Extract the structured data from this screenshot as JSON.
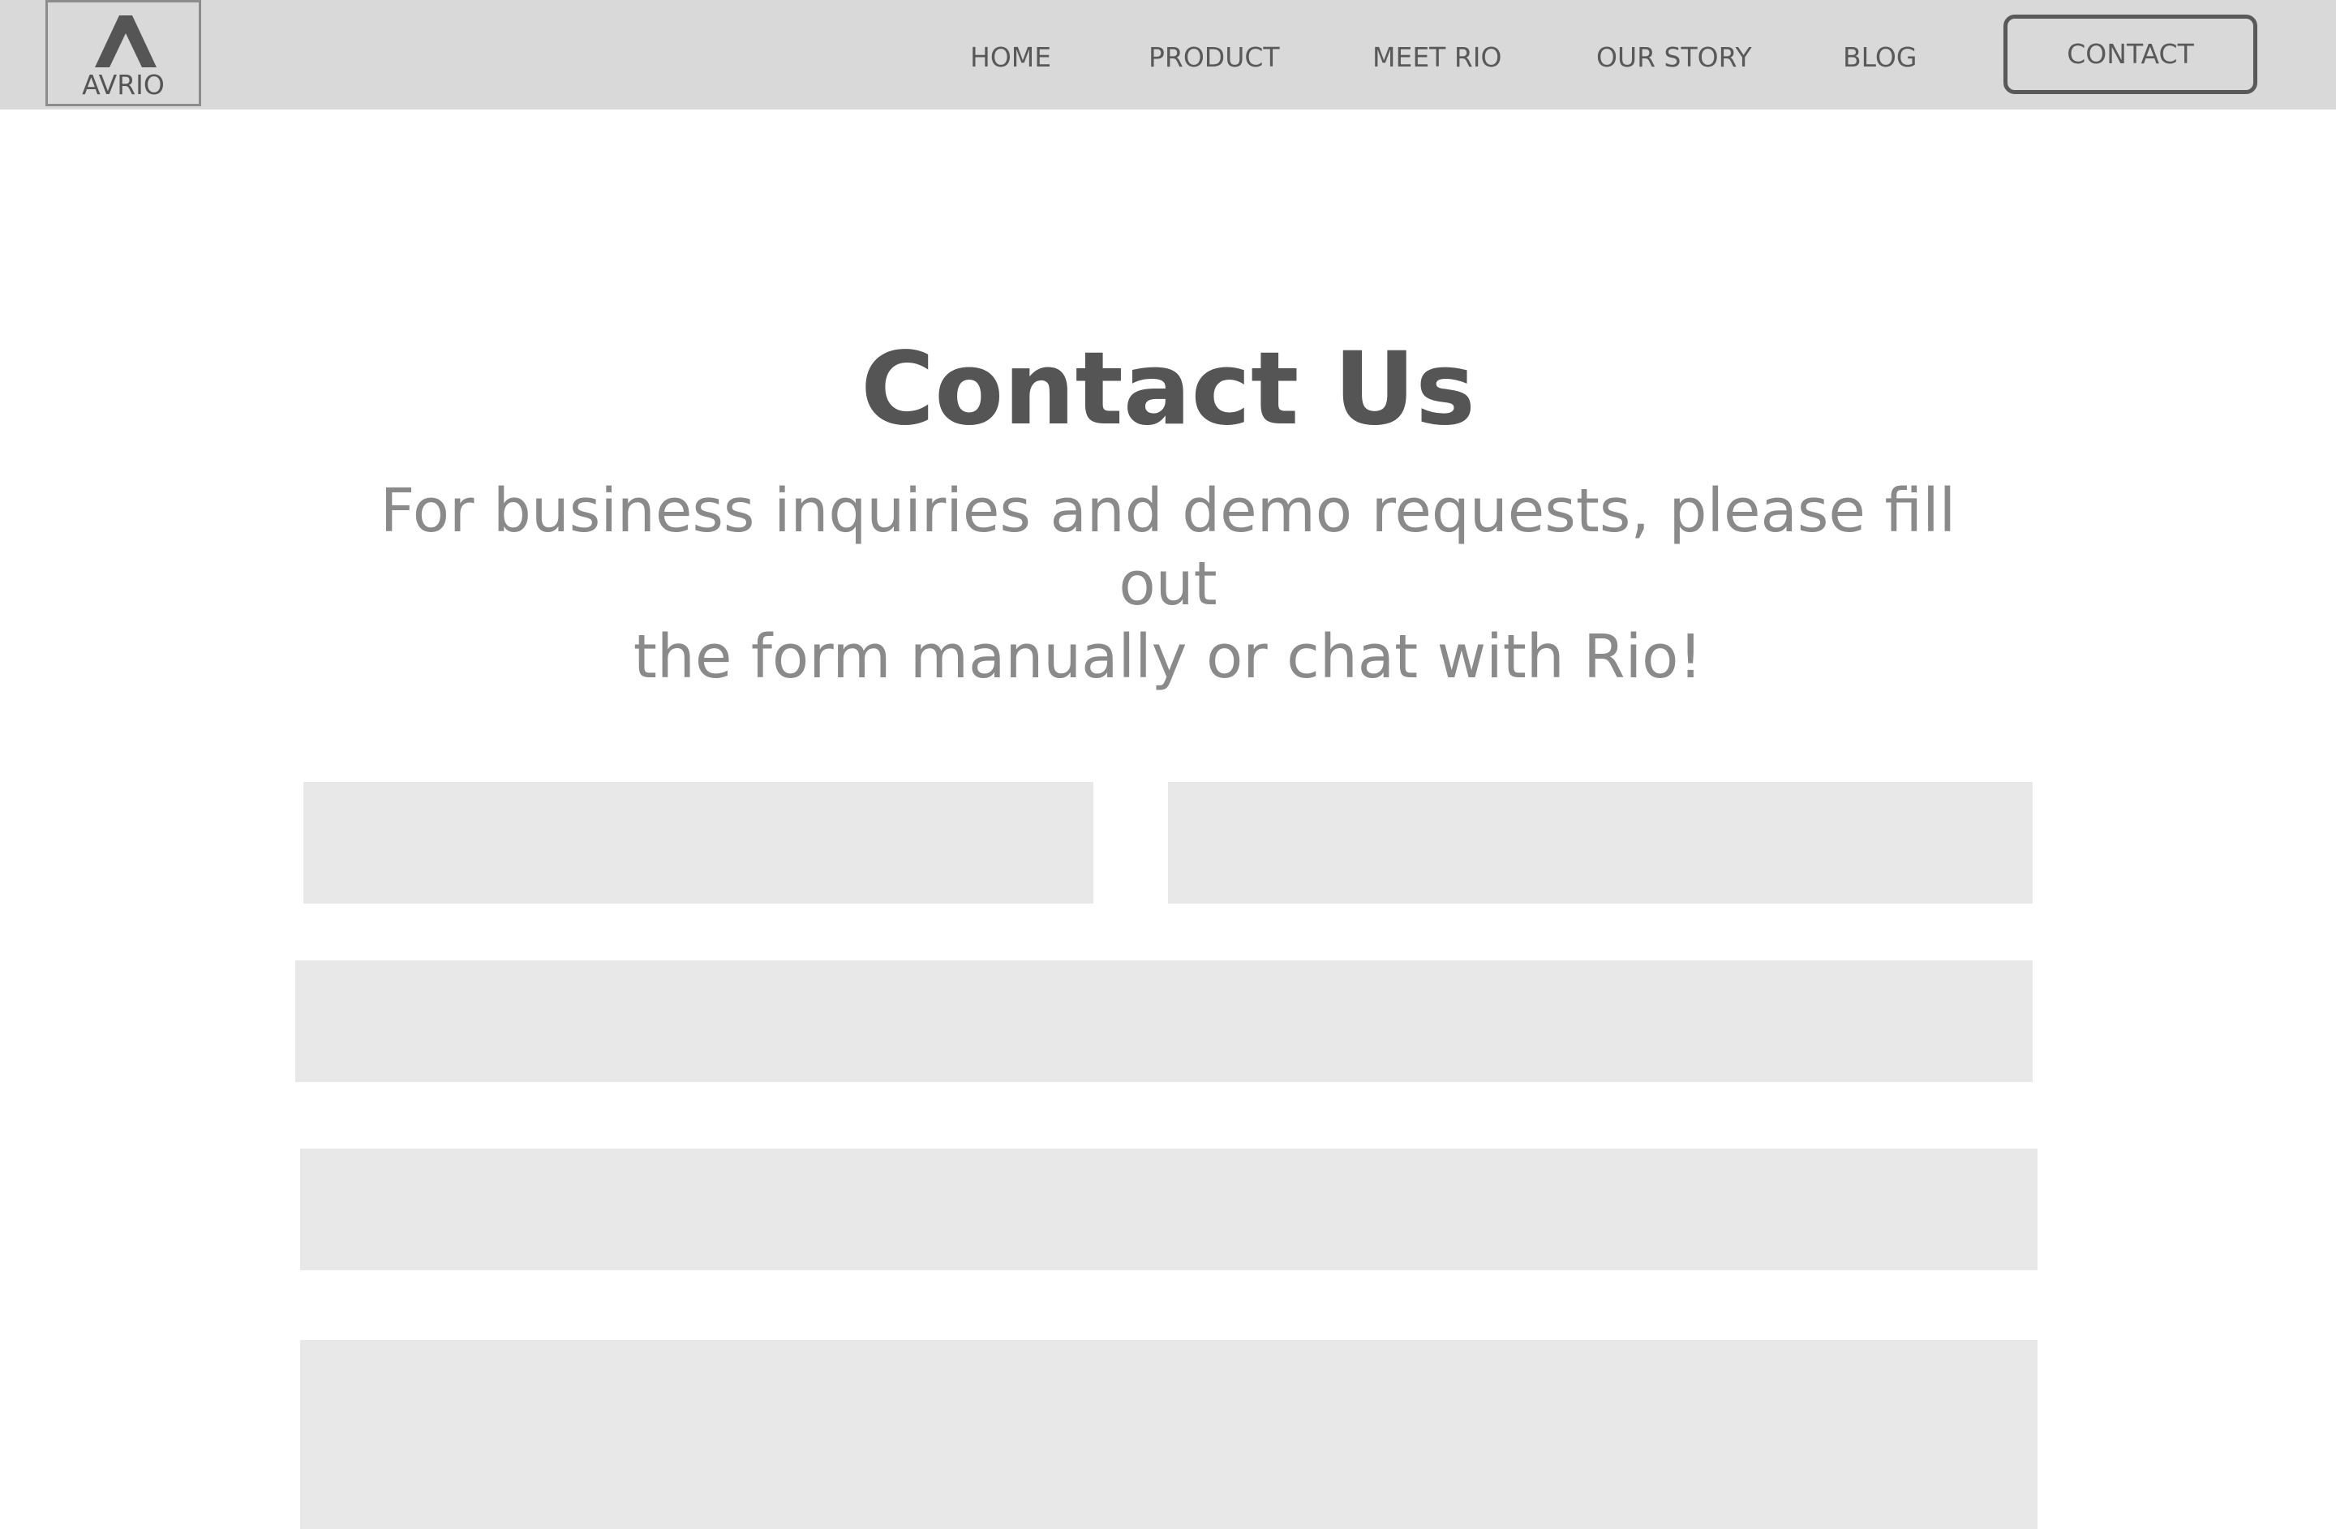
{
  "header": {
    "logo": {
      "text": "AVRIO",
      "icon": "chevron-up-icon"
    },
    "nav": [
      {
        "label": "HOME"
      },
      {
        "label": "PRODUCT"
      },
      {
        "label": "MEET RIO"
      },
      {
        "label": "OUR STORY"
      },
      {
        "label": "BLOG"
      }
    ],
    "contact_button": "CONTACT"
  },
  "main": {
    "title": "Contact Us",
    "subtitle_line1": "For business inquiries and demo requests, please fill out",
    "subtitle_line2": "the form manually or chat with Rio!"
  },
  "form": {
    "first_field": {
      "value": "",
      "placeholder": ""
    },
    "second_field": {
      "value": "",
      "placeholder": ""
    },
    "third_field": {
      "value": "",
      "placeholder": ""
    },
    "fourth_field": {
      "value": "",
      "placeholder": ""
    },
    "message_field": {
      "value": "",
      "placeholder": ""
    }
  },
  "colors": {
    "header_bg": "#d9d9d9",
    "text_dark": "#555555",
    "text_muted": "#8a8a8a",
    "field_bg": "#e8e8e8"
  }
}
